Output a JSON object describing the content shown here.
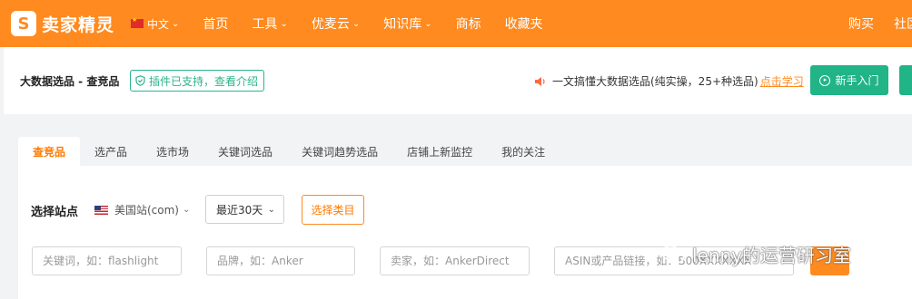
{
  "topnav": {
    "brand_name": "卖家精灵",
    "brand_mark": "S",
    "lang": "中文",
    "items": [
      "首页",
      "工具",
      "优麦云",
      "知识库",
      "商标",
      "收藏夹"
    ],
    "right_items": [
      "购买",
      "社区"
    ]
  },
  "header": {
    "breadcrumb": "大数据选品 - 查竞品",
    "plugin_badge": "插件已支持，查看介绍",
    "notice_text": "一文搞懂大数据选品(纯实操，25+种选品)",
    "notice_link": "点击学习",
    "newbie_button": "新手入门"
  },
  "tabs": [
    {
      "label": "查竞品",
      "active": true
    },
    {
      "label": "选产品",
      "active": false
    },
    {
      "label": "选市场",
      "active": false
    },
    {
      "label": "关键词选品",
      "active": false
    },
    {
      "label": "关键词趋势选品",
      "active": false
    },
    {
      "label": "店铺上新监控",
      "active": false
    },
    {
      "label": "我的关注",
      "active": false
    }
  ],
  "filters": {
    "site_label": "选择站点",
    "site_value": "美国站(com)",
    "days_value": "最近30天",
    "category_button": "选择类目",
    "keyword_placeholder": "关键词，如：flashlight",
    "brand_placeholder": "品牌，如：Anker",
    "seller_placeholder": "卖家，如：AnkerDirect",
    "asin_placeholder": "ASIN或产品链接，如：B00XXXXXXX"
  },
  "watermark": "lenny的运营研习室",
  "colors": {
    "brand_orange": "#ff8a1f",
    "accent_green": "#20b486",
    "badge_green": "#2bb38a"
  }
}
